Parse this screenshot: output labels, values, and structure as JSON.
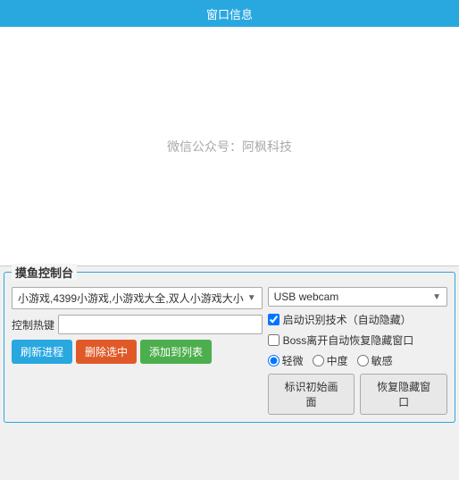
{
  "titleBar": {
    "label": "窗口信息"
  },
  "windowInfo": {
    "placeholder": "微信公众号：阿枫科技"
  },
  "controlPanel": {
    "title": "摸鱼控制台",
    "processDropdown": {
      "value": "小游戏,4399小游戏,小游戏大全,双人小游戏大小",
      "arrow": "▼"
    },
    "webcamDropdown": {
      "value": "USB webcam",
      "arrow": "▼"
    },
    "hotkeyLabel": "控制热键",
    "hotkeyPlaceholder": "",
    "buttons": {
      "refresh": "刷新进程",
      "delete": "删除选中",
      "add": "添加到列表"
    },
    "checkboxes": {
      "autoRecognize": {
        "label": "启动识别技术（自动隐藏）",
        "checked": true
      },
      "bossRestore": {
        "label": "Boss离开自动恢复隐藏窗口",
        "checked": false
      }
    },
    "radios": {
      "options": [
        {
          "label": "轻微",
          "value": "light",
          "checked": true
        },
        {
          "label": "中度",
          "value": "medium",
          "checked": false
        },
        {
          "label": "敏感",
          "value": "sensitive",
          "checked": false
        }
      ]
    },
    "actionButtons": {
      "identify": "标识初始画面",
      "restore": "恢复隐藏窗口"
    }
  }
}
